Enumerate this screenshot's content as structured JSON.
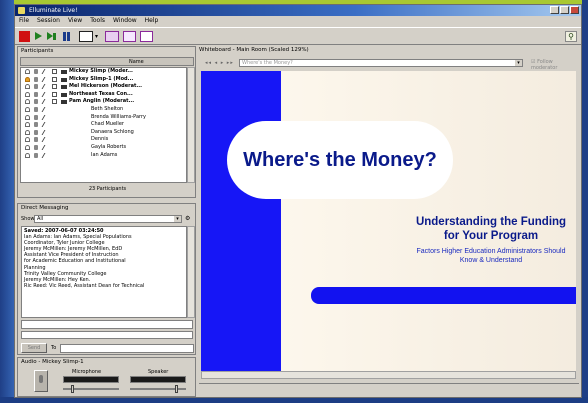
{
  "window": {
    "title": "Elluminate Live!"
  },
  "menu": [
    "File",
    "Session",
    "View",
    "Tools",
    "Window",
    "Help"
  ],
  "participants": {
    "header": "Participants",
    "column_name": "Name",
    "rows": [
      {
        "name": "Mickey Slimp (Moder...",
        "bold": true,
        "hand": false
      },
      {
        "name": "Mickey Slimp-1 (Mod...",
        "bold": true,
        "hand": true
      },
      {
        "name": "Mel Hickerson (Moderat...",
        "bold": true,
        "hand": false
      },
      {
        "name": "Northeast Texas Con...",
        "bold": true,
        "hand": false
      },
      {
        "name": "Pam Anglin (Moderat...",
        "bold": true,
        "hand": false
      },
      {
        "name": "Beth Shelton",
        "bold": false,
        "hand": false
      },
      {
        "name": "Brenda Williams-Parry",
        "bold": false,
        "hand": false
      },
      {
        "name": "Chad Mueller",
        "bold": false,
        "hand": false
      },
      {
        "name": "Danaera Schlong",
        "bold": false,
        "hand": false
      },
      {
        "name": "Dennis",
        "bold": false,
        "hand": false
      },
      {
        "name": "Gayla Roberts",
        "bold": false,
        "hand": false
      },
      {
        "name": "Ian Adams",
        "bold": false,
        "hand": false
      }
    ],
    "count_label": "23 Participants"
  },
  "direct_messaging": {
    "header": "Direct Messaging",
    "show_label": "Show",
    "show_value": "All",
    "log": [
      {
        "text": "Saved: 2007-06-07 03:24:50",
        "bold": true
      },
      {
        "text": "Ian Adams: Ian Adams, Special Populations",
        "bold": false
      },
      {
        "text": "Coordinator, Tyler Junior College",
        "bold": false
      },
      {
        "text": "Jeremy McMillen: Jeremy McMillen, EdD",
        "bold": false
      },
      {
        "text": "Assistant Vice President of Instruction",
        "bold": false
      },
      {
        "text": "  for Academic Education and Institutional",
        "bold": false
      },
      {
        "text": "Planning",
        "bold": false
      },
      {
        "text": "Trinity Valley Community College",
        "bold": false
      },
      {
        "text": "Jeremy McMillen: Hey Ken.",
        "bold": false
      },
      {
        "text": "Ric Reed: Vic Reed, Assistant Dean for Technical",
        "bold": false
      }
    ],
    "send_label": "Send",
    "to_label": "To"
  },
  "audio": {
    "header": "Audio - Mickey Slimp-1",
    "microphone_label": "Microphone",
    "speaker_label": "Speaker",
    "mic_level": 0.15,
    "speaker_level": 0.85
  },
  "whiteboard": {
    "header": "Whiteboard - Main Room (Scaled 129%)",
    "page_select_placeholder": "Where's the Money?",
    "follow_label": "Follow moderator"
  },
  "slide": {
    "title": "Where's the Money?",
    "subtitle": "Understanding the Funding for Your Program",
    "description": "Factors Higher Education Administrators Should Know & Understand"
  },
  "colors": {
    "accent_blue": "#1616f6",
    "title_navy": "#0a1a8a"
  }
}
